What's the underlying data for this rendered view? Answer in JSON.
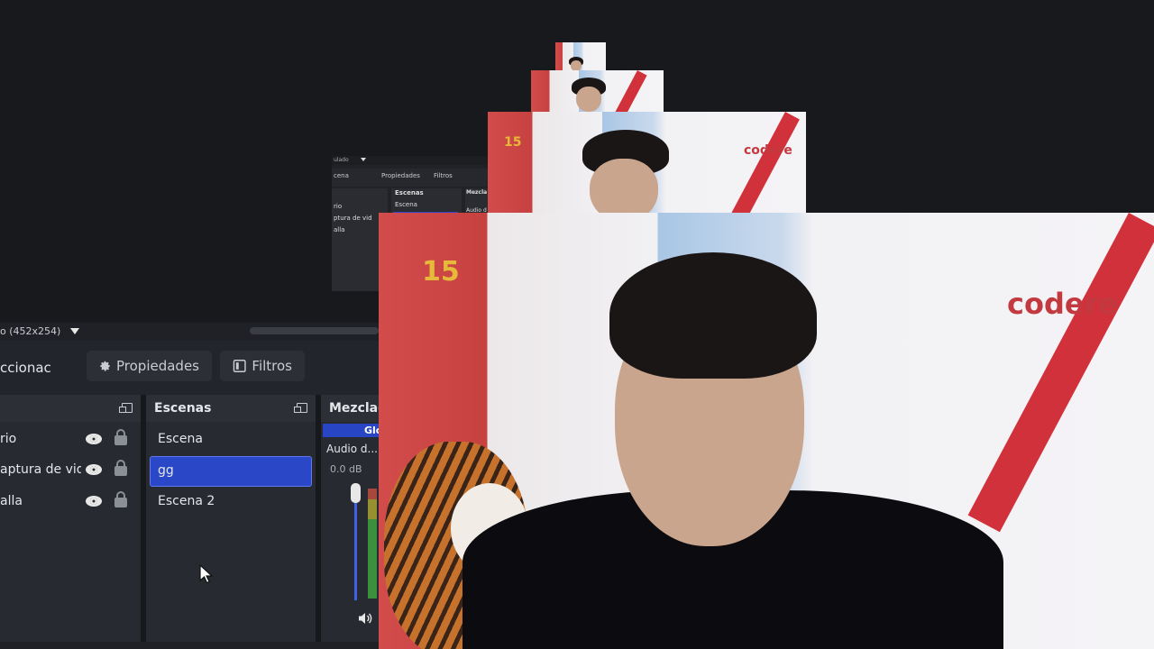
{
  "status": {
    "resolution_label": "o (452x254)"
  },
  "toolbar": {
    "selection_label": "ccionac",
    "properties_label": "Propiedades",
    "filters_label": "Filtros"
  },
  "sources": {
    "items": [
      {
        "name": "rio"
      },
      {
        "name": "aptura de vid"
      },
      {
        "name": "alla"
      }
    ]
  },
  "scenes": {
    "title": "Escenas",
    "items": [
      {
        "name": "Escena",
        "selected": false
      },
      {
        "name": "gg",
        "selected": true
      },
      {
        "name": "Escena 2",
        "selected": false
      }
    ]
  },
  "mixer": {
    "title": "Mezclad",
    "global_label": "Glo",
    "device_label": "Audio d...",
    "level_db": "0.0 dB",
    "volume_level": 0.95
  },
  "webcam": {
    "sponsor_text": "codere",
    "jersey_number": "15"
  },
  "mini_ui": {
    "scene_label": "cena",
    "properties_label": "Propiedades",
    "filters_label": "Filtros",
    "scenes_title": "Escenas",
    "mixer_title": "Mezcla",
    "scene_item": "Escena",
    "audio_label": "Audio d",
    "sources": [
      "rio",
      "ptura de vid",
      "alla"
    ]
  },
  "colors": {
    "accent": "#2a47c7",
    "panel_bg": "#272a30",
    "header_bg": "#2c2f36"
  }
}
